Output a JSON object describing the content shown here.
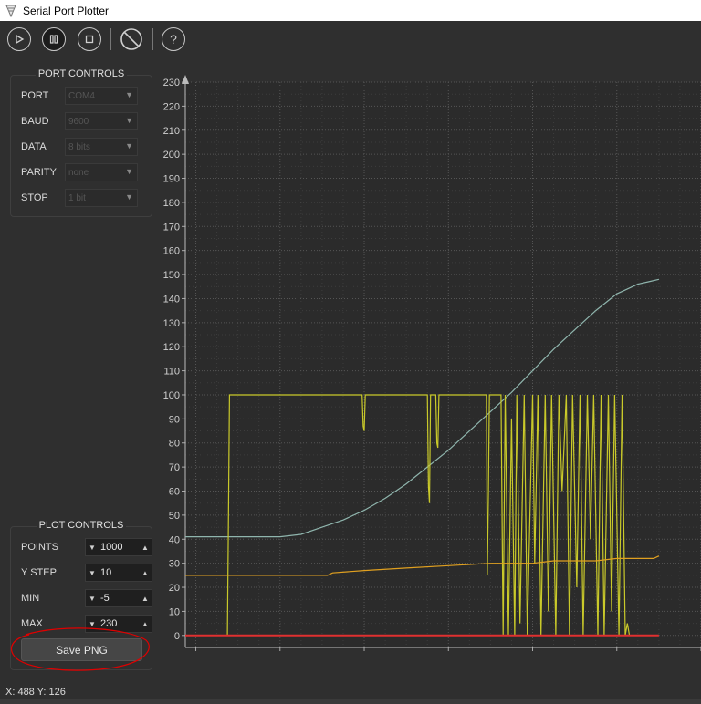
{
  "window": {
    "title": "Serial Port Plotter"
  },
  "toolbar": {
    "buttons": [
      {
        "name": "play-button",
        "icon": "play-icon"
      },
      {
        "name": "pause-button",
        "icon": "pause-icon"
      },
      {
        "name": "stop-button",
        "icon": "stop-icon"
      },
      {
        "name": "clear-button",
        "icon": "no-symbol-icon"
      },
      {
        "name": "help-button",
        "icon": "help-icon",
        "glyph": "?"
      }
    ]
  },
  "port_controls": {
    "title": "PORT CONTROLS",
    "rows": [
      {
        "label": "PORT",
        "value": "COM4"
      },
      {
        "label": "BAUD",
        "value": "9600"
      },
      {
        "label": "DATA",
        "value": "8 bits"
      },
      {
        "label": "PARITY",
        "value": "none"
      },
      {
        "label": "STOP",
        "value": "1 bit"
      }
    ]
  },
  "plot_controls": {
    "title": "PLOT CONTROLS",
    "rows": [
      {
        "label": "POINTS",
        "value": "1000"
      },
      {
        "label": "Y STEP",
        "value": "10"
      },
      {
        "label": "MIN",
        "value": "-5"
      },
      {
        "label": "MAX",
        "value": "230"
      }
    ],
    "save_label": "Save PNG"
  },
  "status": {
    "coords": "X: 488 Y: 126"
  },
  "colors": {
    "plot_bg": "#2b2b2b",
    "grid": "#555555",
    "axis_text": "#d0d0d0",
    "highlight_circle": "#e00000"
  },
  "chart_data": {
    "type": "line",
    "title": "",
    "xlabel": "",
    "ylabel": "",
    "xlim": [
      390,
      880
    ],
    "ylim": [
      -5,
      230
    ],
    "xticks": [
      400,
      480,
      560,
      640,
      720,
      800,
      880
    ],
    "yticks": [
      0,
      10,
      20,
      30,
      40,
      50,
      60,
      70,
      80,
      90,
      100,
      110,
      120,
      130,
      140,
      150,
      160,
      170,
      180,
      190,
      200,
      210,
      220,
      230
    ],
    "grid": true,
    "series": [
      {
        "color": "#8fb5ad",
        "x": [
          390,
          420,
          450,
          480,
          500,
          520,
          540,
          560,
          580,
          600,
          620,
          640,
          660,
          680,
          700,
          720,
          740,
          760,
          780,
          800,
          810,
          820,
          830,
          840
        ],
        "y": [
          41,
          41,
          41,
          41,
          42,
          45,
          48,
          52,
          57,
          63,
          70,
          77,
          85,
          93,
          101,
          110,
          119,
          127,
          135,
          142,
          144,
          146,
          147,
          148
        ]
      },
      {
        "color": "#c9c92a",
        "x": [
          390,
          430,
          431,
          432,
          433,
          558,
          559,
          560,
          561,
          620,
          621,
          622,
          623,
          628,
          629,
          630,
          631,
          676,
          677,
          678,
          679,
          690,
          692,
          694,
          697,
          700,
          703,
          705,
          708,
          712,
          715,
          720,
          722,
          725,
          728,
          732,
          735,
          738,
          742,
          745,
          748,
          752,
          755,
          758,
          762,
          765,
          768,
          772,
          775,
          778,
          782,
          785,
          788,
          792,
          795,
          798,
          802,
          805,
          808,
          810,
          812
        ],
        "y": [
          0,
          0,
          50,
          100,
          100,
          100,
          87,
          85,
          100,
          100,
          62,
          55,
          100,
          100,
          80,
          78,
          100,
          100,
          25,
          60,
          100,
          100,
          0,
          100,
          0,
          90,
          0,
          100,
          5,
          100,
          0,
          100,
          30,
          100,
          0,
          100,
          10,
          100,
          0,
          100,
          60,
          100,
          0,
          100,
          20,
          100,
          0,
          100,
          40,
          100,
          0,
          100,
          0,
          100,
          10,
          100,
          0,
          100,
          0,
          5,
          0
        ]
      },
      {
        "color": "#e0a020",
        "x": [
          390,
          440,
          480,
          520,
          525,
          530,
          560,
          600,
          640,
          680,
          700,
          720,
          740,
          760,
          780,
          800,
          820,
          835,
          840
        ],
        "y": [
          25,
          25,
          25,
          25,
          25,
          26,
          27,
          28,
          29,
          30,
          30,
          30,
          31,
          31,
          31,
          32,
          32,
          32,
          33
        ]
      },
      {
        "color": "#e03030",
        "x": [
          390,
          840
        ],
        "y": [
          0,
          0
        ]
      }
    ]
  }
}
